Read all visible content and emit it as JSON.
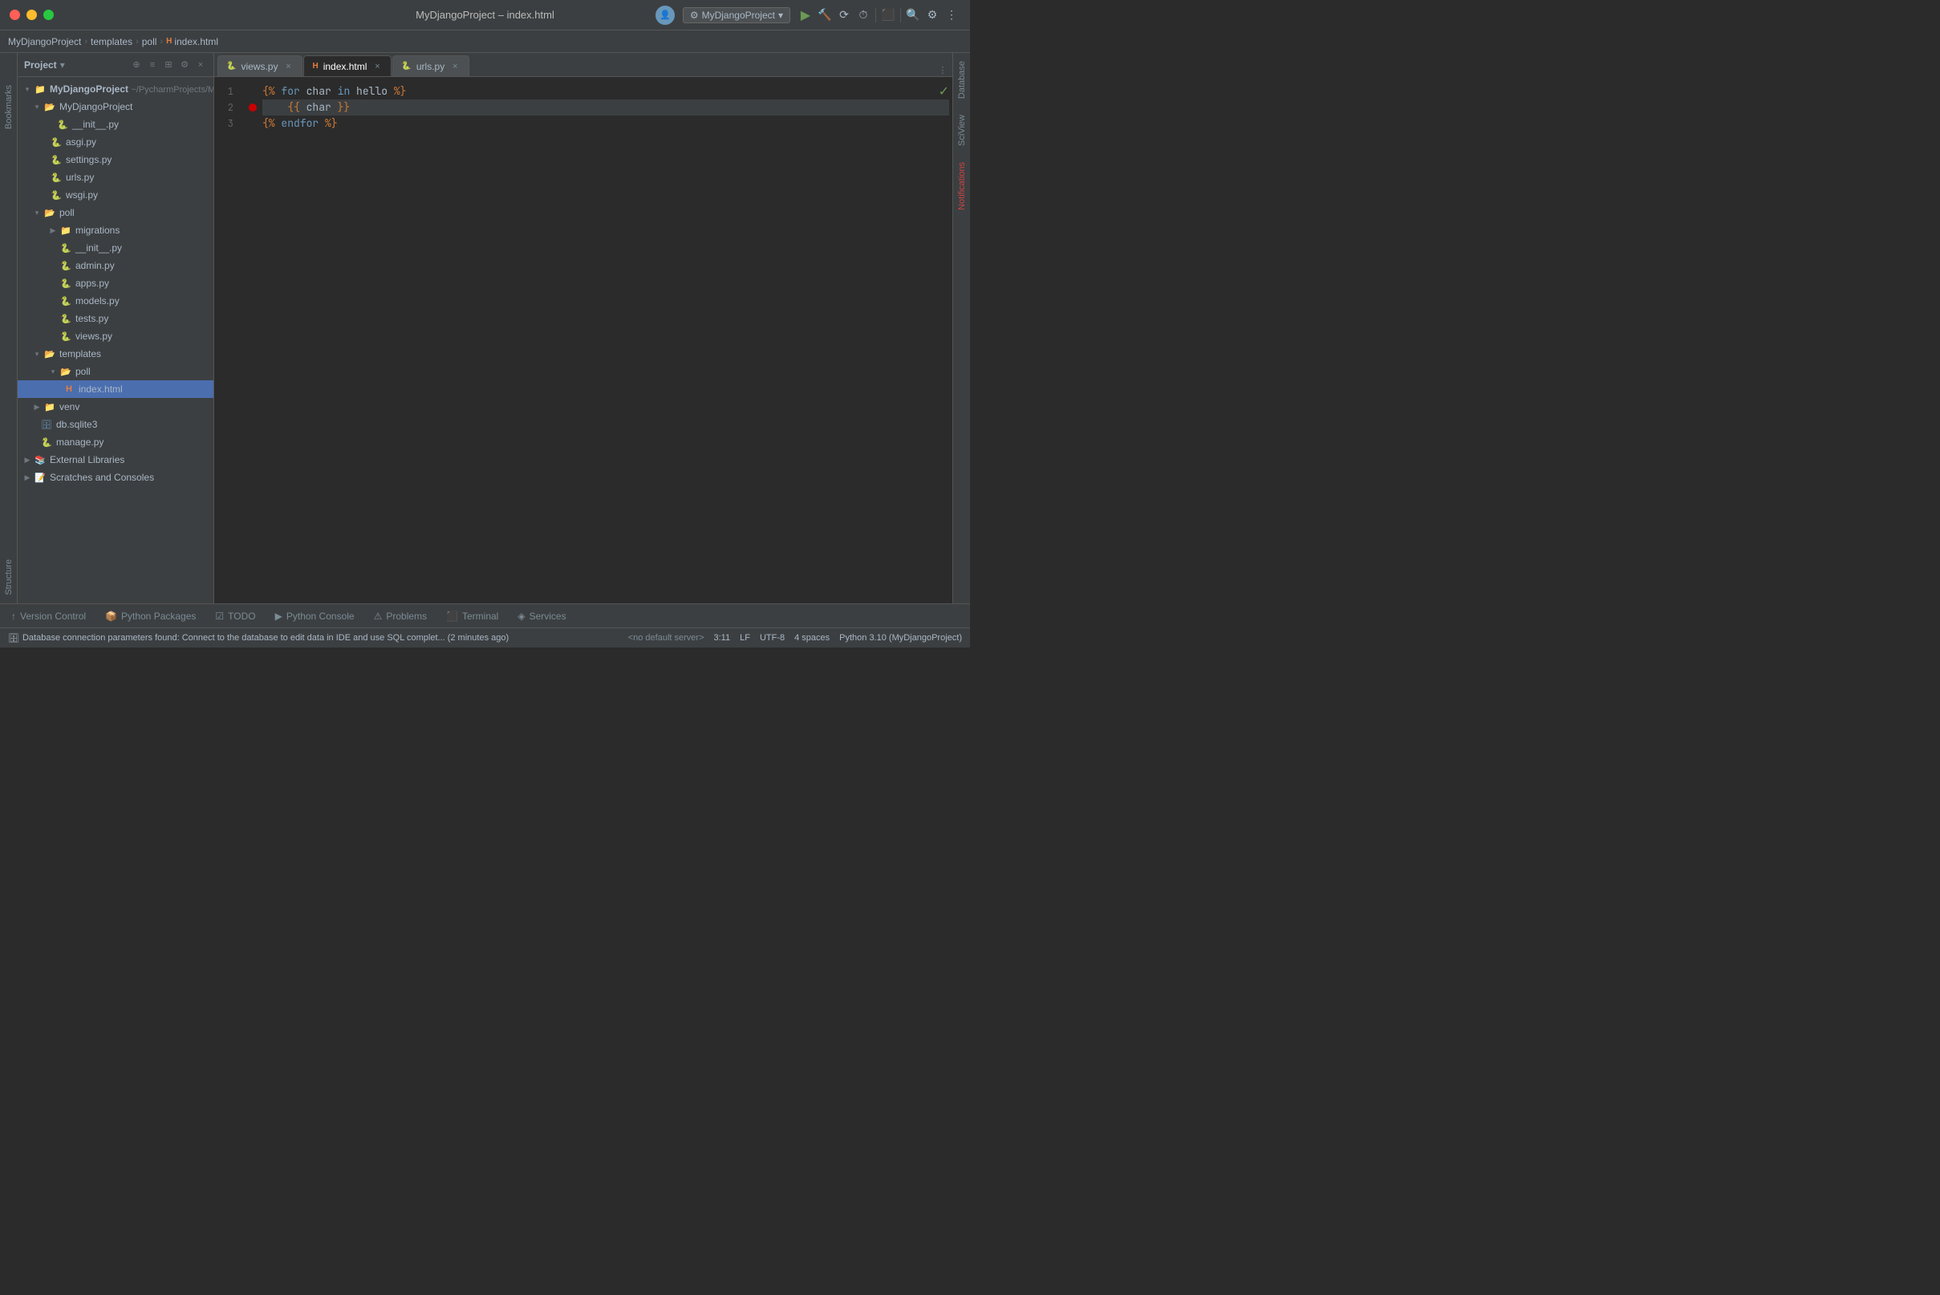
{
  "titleBar": {
    "title": "MyDjangoProject – index.html",
    "traffic": [
      "close",
      "minimize",
      "maximize"
    ]
  },
  "breadcrumb": {
    "items": [
      "MyDjangoProject",
      "templates",
      "poll",
      "index.html"
    ]
  },
  "projectPanel": {
    "title": "Project",
    "dropdown": "▾"
  },
  "fileTree": {
    "root": {
      "label": "MyDjangoProject",
      "path": "~/PycharmProjects/MyDjangoProject"
    },
    "items": [
      {
        "id": "mydjangoproject-folder",
        "indent": 1,
        "arrow": "▾",
        "icon": "folder",
        "label": "MyDjangoProject",
        "type": "folder"
      },
      {
        "id": "init-py",
        "indent": 3,
        "arrow": "",
        "icon": "py",
        "label": "__init__.py",
        "type": "file"
      },
      {
        "id": "asgi-py",
        "indent": 3,
        "arrow": "",
        "icon": "py",
        "label": "asgi.py",
        "type": "file"
      },
      {
        "id": "settings-py",
        "indent": 3,
        "arrow": "",
        "icon": "py",
        "label": "settings.py",
        "type": "file"
      },
      {
        "id": "urls-py",
        "indent": 3,
        "arrow": "",
        "icon": "py",
        "label": "urls.py",
        "type": "file"
      },
      {
        "id": "wsgi-py",
        "indent": 3,
        "arrow": "",
        "icon": "py",
        "label": "wsgi.py",
        "type": "file"
      },
      {
        "id": "poll-folder",
        "indent": 1,
        "arrow": "▾",
        "icon": "folder",
        "label": "poll",
        "type": "folder"
      },
      {
        "id": "migrations-folder",
        "indent": 3,
        "arrow": "▶",
        "icon": "folder",
        "label": "migrations",
        "type": "folder"
      },
      {
        "id": "poll-init-py",
        "indent": 3,
        "arrow": "",
        "icon": "py",
        "label": "__init__.py",
        "type": "file"
      },
      {
        "id": "admin-py",
        "indent": 3,
        "arrow": "",
        "icon": "py",
        "label": "admin.py",
        "type": "file"
      },
      {
        "id": "apps-py",
        "indent": 3,
        "arrow": "",
        "icon": "py",
        "label": "apps.py",
        "type": "file"
      },
      {
        "id": "models-py",
        "indent": 3,
        "arrow": "",
        "icon": "py",
        "label": "models.py",
        "type": "file"
      },
      {
        "id": "tests-py",
        "indent": 3,
        "arrow": "",
        "icon": "py",
        "label": "tests.py",
        "type": "file"
      },
      {
        "id": "views-py",
        "indent": 3,
        "arrow": "",
        "icon": "py",
        "label": "views.py",
        "type": "file"
      },
      {
        "id": "templates-folder",
        "indent": 1,
        "arrow": "▾",
        "icon": "folder",
        "label": "templates",
        "type": "folder"
      },
      {
        "id": "poll-sub-folder",
        "indent": 3,
        "arrow": "▾",
        "icon": "folder",
        "label": "poll",
        "type": "folder"
      },
      {
        "id": "index-html",
        "indent": 5,
        "arrow": "",
        "icon": "html",
        "label": "index.html",
        "type": "file",
        "selected": true
      },
      {
        "id": "venv-folder",
        "indent": 1,
        "arrow": "▶",
        "icon": "folder",
        "label": "venv",
        "type": "folder"
      },
      {
        "id": "db-sqlite3",
        "indent": 2,
        "arrow": "",
        "icon": "db",
        "label": "db.sqlite3",
        "type": "file"
      },
      {
        "id": "manage-py",
        "indent": 2,
        "arrow": "",
        "icon": "py",
        "label": "manage.py",
        "type": "file"
      },
      {
        "id": "external-libraries",
        "indent": 0,
        "arrow": "▶",
        "icon": "ext",
        "label": "External Libraries",
        "type": "folder"
      },
      {
        "id": "scratches",
        "indent": 0,
        "arrow": "▶",
        "icon": "scratch",
        "label": "Scratches and Consoles",
        "type": "folder"
      }
    ]
  },
  "editorTabs": [
    {
      "id": "views-tab",
      "label": "views.py",
      "icon": "py",
      "active": false
    },
    {
      "id": "index-tab",
      "label": "index.html",
      "icon": "html",
      "active": true
    },
    {
      "id": "urls-tab",
      "label": "urls.py",
      "icon": "py",
      "active": false
    }
  ],
  "codeLines": [
    {
      "num": 1,
      "content": "{% for char in hello %}",
      "highlighted": false
    },
    {
      "num": 2,
      "content": "    {{ char }}",
      "highlighted": true
    },
    {
      "num": 3,
      "content": "{% endfor %}",
      "highlighted": false
    }
  ],
  "rightTabs": [
    "Database",
    "SciView",
    "Notifications"
  ],
  "leftVtabs": [
    "Bookmarks",
    "Structure"
  ],
  "bottomTabs": [
    {
      "id": "version-control",
      "icon": "↑",
      "label": "Version Control"
    },
    {
      "id": "python-packages",
      "icon": "📦",
      "label": "Python Packages"
    },
    {
      "id": "todo",
      "icon": "☑",
      "label": "TODO"
    },
    {
      "id": "python-console",
      "icon": "▶",
      "label": "Python Console"
    },
    {
      "id": "problems",
      "icon": "⚠",
      "label": "Problems"
    },
    {
      "id": "terminal",
      "icon": "⬛",
      "label": "Terminal"
    },
    {
      "id": "services",
      "icon": "◈",
      "label": "Services"
    }
  ],
  "statusBar": {
    "message": "Database connection parameters found: Connect to the database to edit data in IDE and use SQL complet... (2 minutes ago)",
    "server": "<no default server>",
    "position": "3:11",
    "encoding": "LF",
    "charset": "UTF-8",
    "indent": "4 spaces",
    "python": "Python 3.10 (MyDjangoProject)"
  },
  "runConfig": {
    "label": "MyDjangoProject",
    "icon": "⚙"
  }
}
